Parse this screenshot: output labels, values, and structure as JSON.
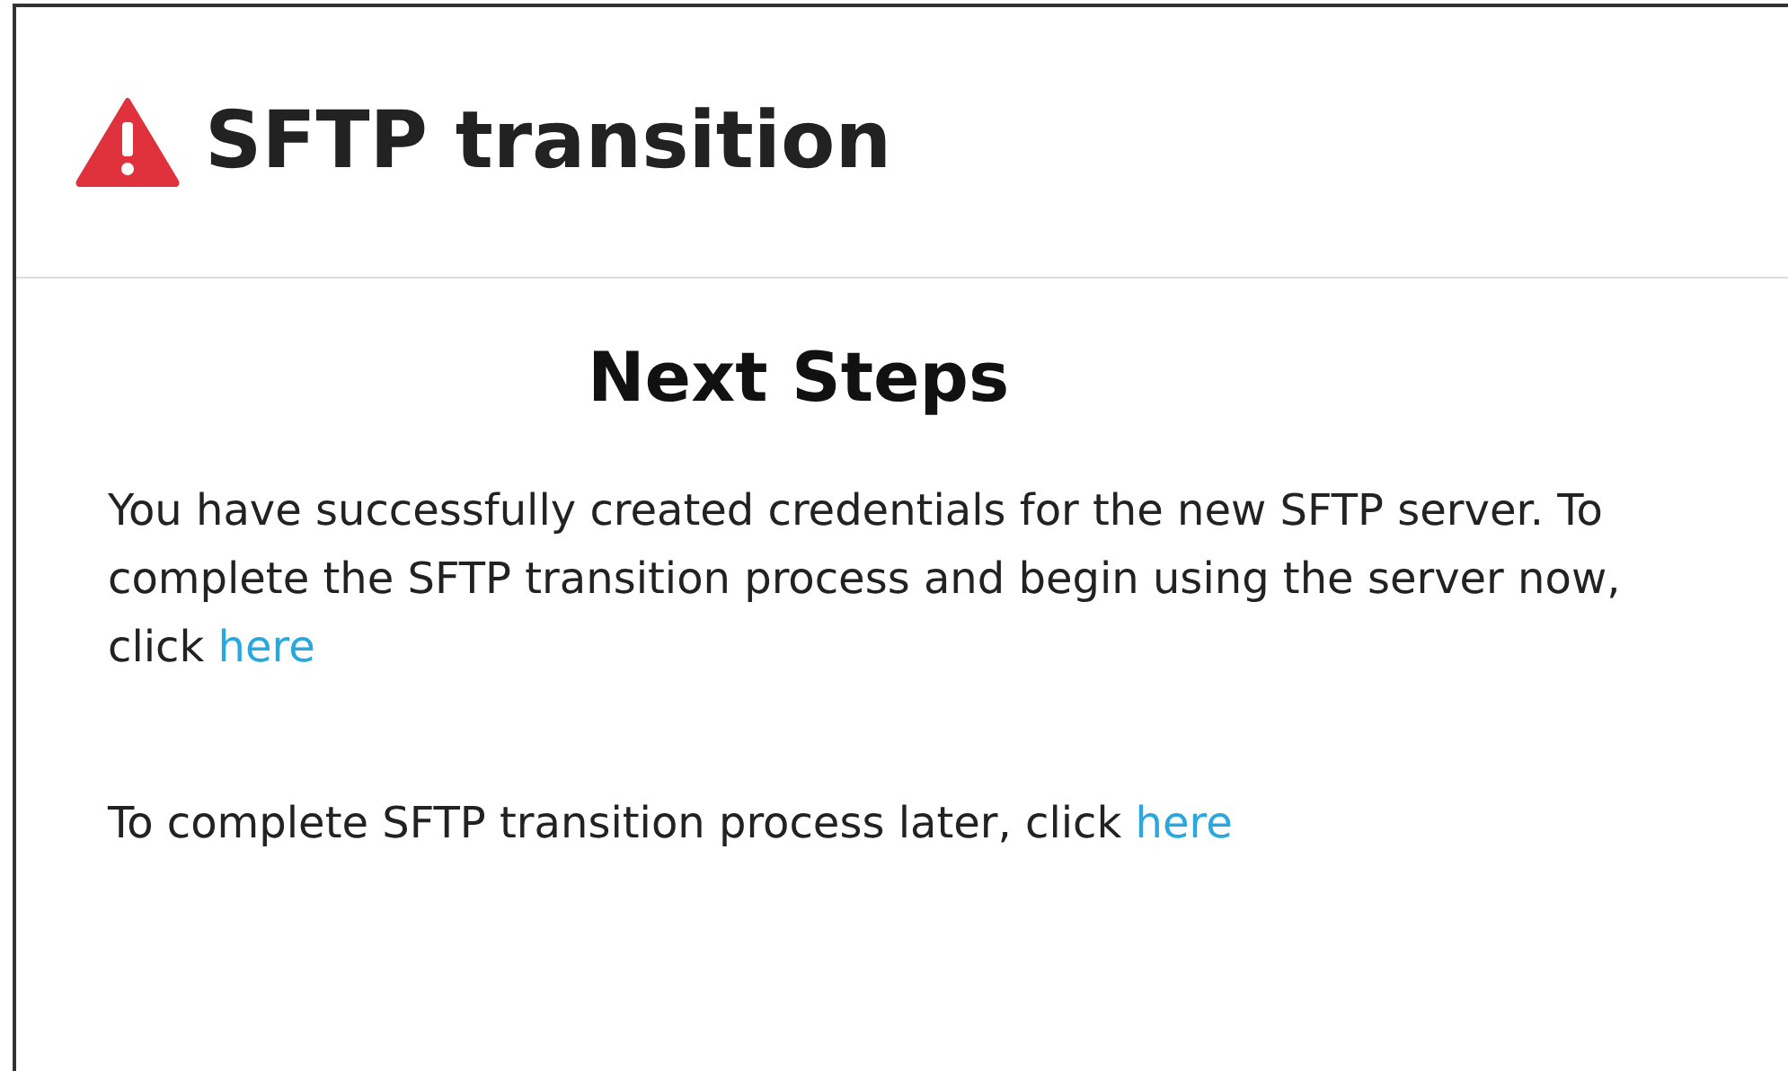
{
  "dialog": {
    "title": "SFTP transition",
    "heading": "Next Steps",
    "paragraphs": [
      {
        "text": "You have successfully created credentials for the new SFTP server. To complete the SFTP transition process and begin using the server now, click",
        "link": "here"
      },
      {
        "text": "To complete SFTP transition process later, click",
        "link": "here"
      }
    ]
  }
}
